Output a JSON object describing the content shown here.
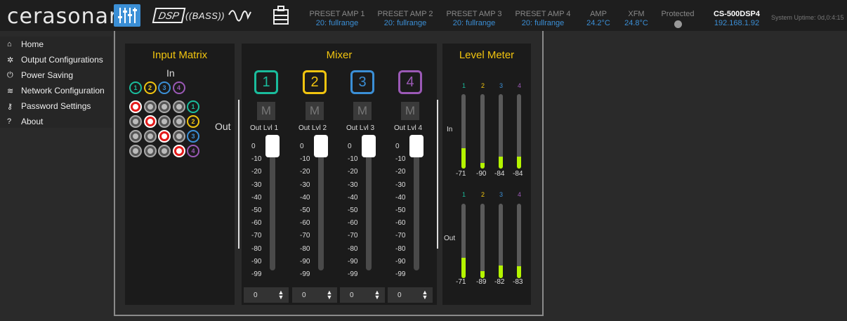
{
  "header": {
    "logo": "cerasonar",
    "presets": [
      {
        "title": "PRESET AMP 1",
        "value": "20: fullrange"
      },
      {
        "title": "PRESET AMP 2",
        "value": "20: fullrange"
      },
      {
        "title": "PRESET AMP 3",
        "value": "20: fullrange"
      },
      {
        "title": "PRESET AMP 4",
        "value": "20: fullrange"
      }
    ],
    "amp": {
      "title": "AMP",
      "value": "24.2°C"
    },
    "xfm": {
      "title": "XFM",
      "value": "24.8°C"
    },
    "protected": {
      "title": "Protected",
      "status": "off"
    },
    "device": {
      "model": "CS-500DSP4",
      "ip": "192.168.1.92"
    },
    "uptime": "System Uptime: 0d,0:4:15",
    "tools": {
      "dsp": "DSP",
      "bass": "BASS",
      "icons": [
        "mixer-sliders-icon",
        "dsp-icon",
        "bass-icon",
        "eq-curve-icon",
        "preset-icon"
      ]
    }
  },
  "sidebar": {
    "items": [
      {
        "label": "Home",
        "icon": "home-icon"
      },
      {
        "label": "Output Configurations",
        "icon": "gear-icon"
      },
      {
        "label": "Power Saving",
        "icon": "power-icon"
      },
      {
        "label": "Network Configuration",
        "icon": "wifi-icon"
      },
      {
        "label": "Password Settings",
        "icon": "key-icon"
      },
      {
        "label": "About",
        "icon": "question-icon"
      }
    ]
  },
  "matrix": {
    "title": "Input Matrix",
    "in_label": "In",
    "out_label": "Out",
    "inputs": [
      "1",
      "2",
      "3",
      "4"
    ],
    "outputs": [
      "1",
      "2",
      "3",
      "4"
    ],
    "routing": [
      [
        1,
        0,
        0,
        0
      ],
      [
        0,
        1,
        0,
        0
      ],
      [
        0,
        0,
        1,
        0
      ],
      [
        0,
        0,
        0,
        1
      ]
    ]
  },
  "mixer": {
    "title": "Mixer",
    "mute_label": "M",
    "channels": [
      {
        "number": "1",
        "label": "Out Lvl 1",
        "level_db": 0,
        "stepper": "0"
      },
      {
        "number": "2",
        "label": "Out Lvl 2",
        "level_db": 0,
        "stepper": "0"
      },
      {
        "number": "3",
        "label": "Out Lvl 3",
        "level_db": 0,
        "stepper": "0"
      },
      {
        "number": "4",
        "label": "Out Lvl 4",
        "level_db": 0,
        "stepper": "0"
      }
    ],
    "scale": [
      "0",
      "-10",
      "-20",
      "-30",
      "-40",
      "-50",
      "-60",
      "-70",
      "-80",
      "-90",
      "-99"
    ]
  },
  "meter": {
    "title": "Level Meter",
    "in_label": "In",
    "out_label": "Out",
    "channels": [
      "1",
      "2",
      "3",
      "4"
    ],
    "in_values": [
      "-71",
      "-90",
      "-84",
      "-84"
    ],
    "in_fill": [
      0.27,
      0.08,
      0.16,
      0.16
    ],
    "out_values": [
      "-71",
      "-89",
      "-82",
      "-83"
    ],
    "out_fill": [
      0.27,
      0.09,
      0.17,
      0.16
    ]
  },
  "colors": {
    "ch1": "#1abc9c",
    "ch2": "#f1c40f",
    "ch3": "#3b8fd6",
    "ch4": "#9b59b6",
    "accent": "#3b8fd6",
    "title": "#f1c40f",
    "active_node": "#e31b1b",
    "meter": "#b5f500"
  }
}
